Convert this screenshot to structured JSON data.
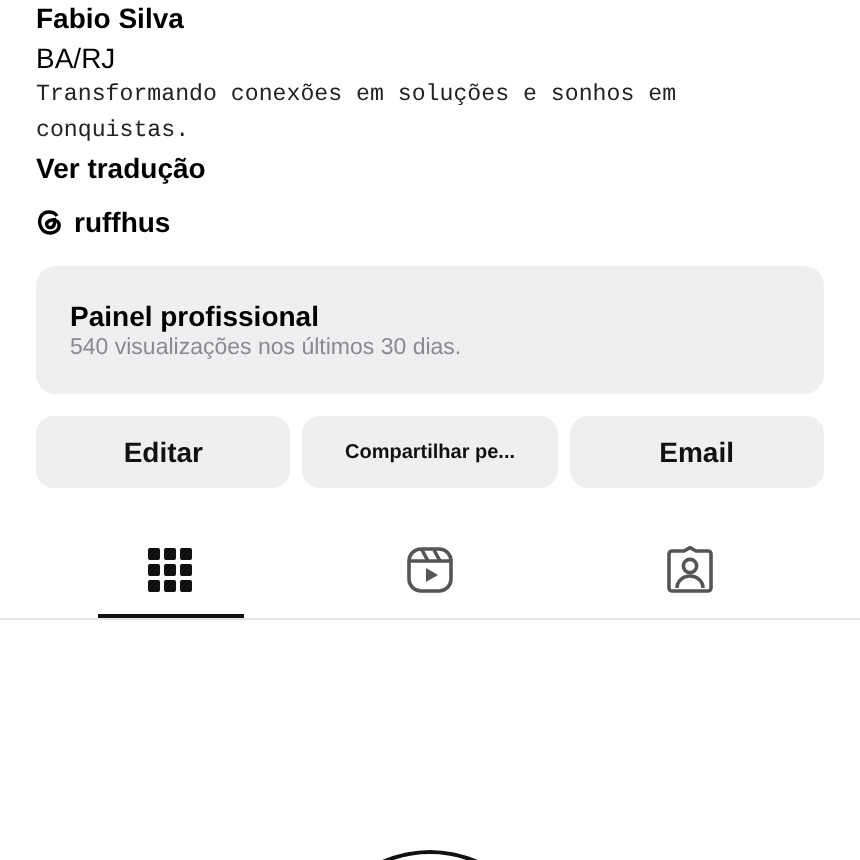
{
  "profile": {
    "name": "Fabio Silva",
    "category": "BA/RJ",
    "bio": "Transformando conexões em soluções e sonhos em conquistas.",
    "translate_link": "Ver tradução",
    "threads_handle": "ruffhus"
  },
  "dashboard": {
    "title": "Painel profissional",
    "subtitle": "540 visualizações nos últimos 30 dias."
  },
  "buttons": [
    {
      "label": "Editar",
      "kind": "large"
    },
    {
      "label": "Compartilhar pe...",
      "kind": "small"
    },
    {
      "label": "Email",
      "kind": "large"
    }
  ],
  "tabs": [
    {
      "kind": "grid",
      "selected": true
    },
    {
      "kind": "reels",
      "selected": false
    },
    {
      "kind": "tagged",
      "selected": false
    }
  ]
}
